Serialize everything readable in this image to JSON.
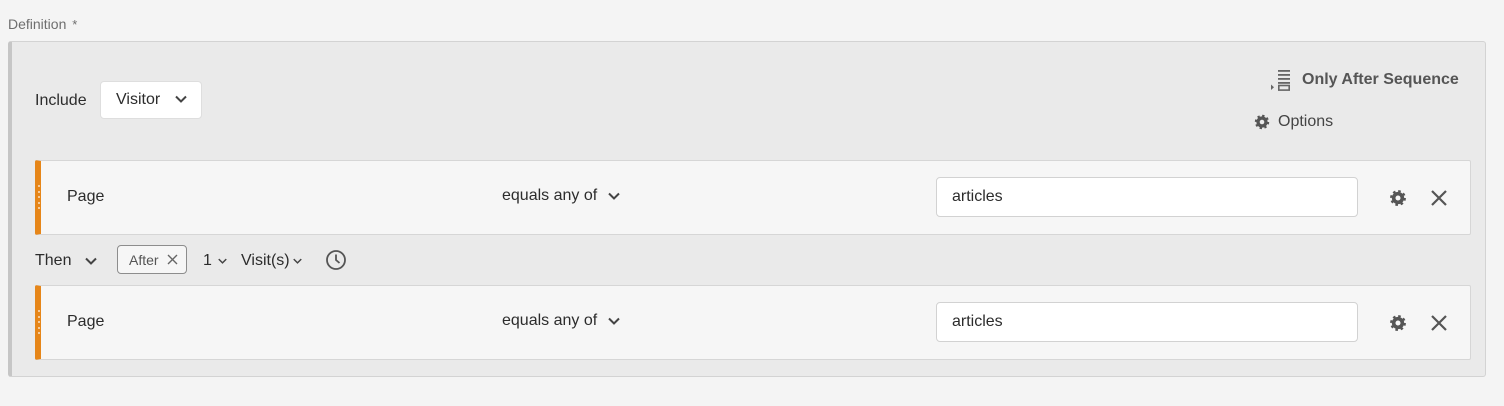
{
  "definition": {
    "label": "Definition",
    "required_mark": "*"
  },
  "include": {
    "label": "Include",
    "selected": "Visitor"
  },
  "top_actions": {
    "only_after_sequence": "Only After Sequence",
    "options": "Options"
  },
  "rules": [
    {
      "dimension": "Page",
      "operator": "equals any of",
      "value": "articles"
    },
    {
      "dimension": "Page",
      "operator": "equals any of",
      "value": "articles"
    }
  ],
  "then": {
    "label": "Then",
    "tag": "After",
    "count": "1",
    "unit": "Visit(s)"
  },
  "colors": {
    "accent_orange": "#e68619",
    "icon_gray": "#5a5a5a"
  }
}
